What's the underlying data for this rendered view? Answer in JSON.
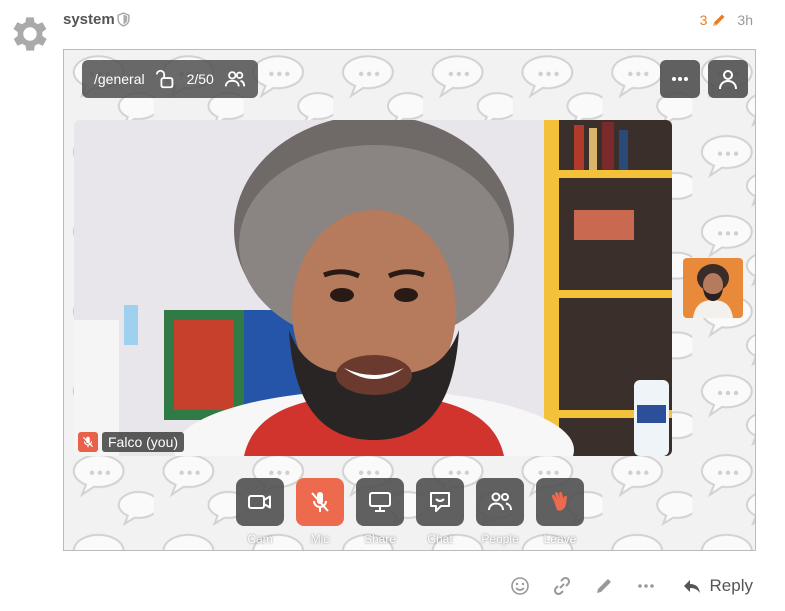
{
  "post": {
    "username": "system",
    "edit_count": "3",
    "age": "3h"
  },
  "call": {
    "room": "/general",
    "participants": "2/50",
    "self_label": "Falco (you)",
    "controls": [
      {
        "label": "Cam",
        "icon": "camera-icon"
      },
      {
        "label": "Mic",
        "icon": "mic-off-icon"
      },
      {
        "label": "Share",
        "icon": "screen-share-icon"
      },
      {
        "label": "Chat",
        "icon": "chat-icon"
      },
      {
        "label": "People",
        "icon": "people-icon"
      },
      {
        "label": "Leave",
        "icon": "wave-hand-icon"
      }
    ]
  },
  "actions": {
    "reply_label": "Reply"
  },
  "colors": {
    "accent": "#e67e22",
    "danger": "#ee6a4f",
    "control_bg": "#505050"
  }
}
